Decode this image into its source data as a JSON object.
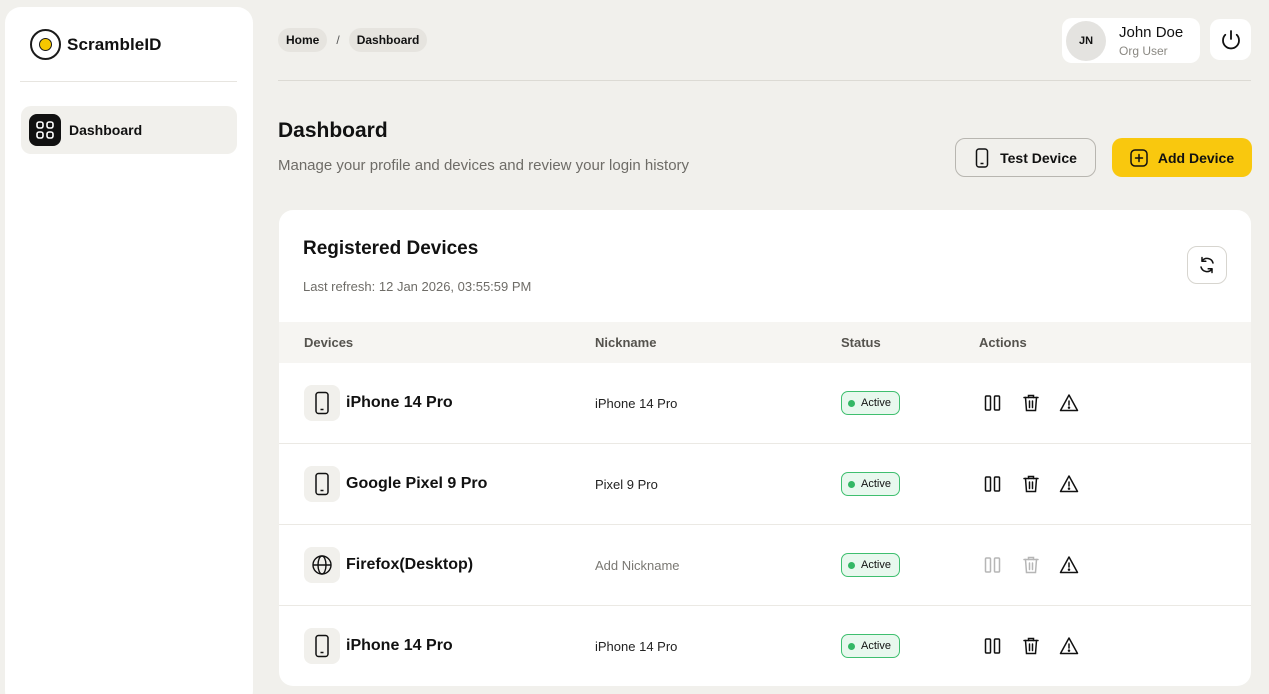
{
  "app": {
    "name": "ScrambleID"
  },
  "sidebar": {
    "items": [
      {
        "label": "Dashboard",
        "icon": "grid-icon"
      }
    ]
  },
  "breadcrumb": [
    "Home",
    "Dashboard"
  ],
  "breadcrumb_separator": "/",
  "user": {
    "initials": "JN",
    "name": "John Doe",
    "role": "Org User"
  },
  "header": {
    "title": "Dashboard",
    "subtitle": "Manage your profile and devices and review your login history",
    "test_button": "Test Device",
    "add_button": "Add Device"
  },
  "devices_card": {
    "title": "Registered Devices",
    "last_refresh": "Last refresh: 12 Jan 2026, 03:55:59 PM",
    "columns": [
      "Devices",
      "Nickname",
      "Status",
      "Actions"
    ],
    "rows": [
      {
        "icon": "phone-icon",
        "device": "iPhone 14 Pro",
        "nickname": "iPhone 14 Pro",
        "status": "Active",
        "actions_enabled": true
      },
      {
        "icon": "phone-icon",
        "device": "Google Pixel 9 Pro",
        "nickname": "Pixel 9 Pro",
        "status": "Active",
        "actions_enabled": true
      },
      {
        "icon": "globe-icon",
        "device": "Firefox(Desktop)",
        "nickname": "Add Nickname",
        "status": "Active",
        "actions_enabled": false
      },
      {
        "icon": "phone-icon",
        "device": "iPhone 14 Pro",
        "nickname": "iPhone 14 Pro",
        "status": "Active",
        "actions_enabled": true
      }
    ]
  },
  "colors": {
    "accent": "#f9c80e",
    "active_green": "#34b765",
    "background": "#f1f0ec"
  }
}
